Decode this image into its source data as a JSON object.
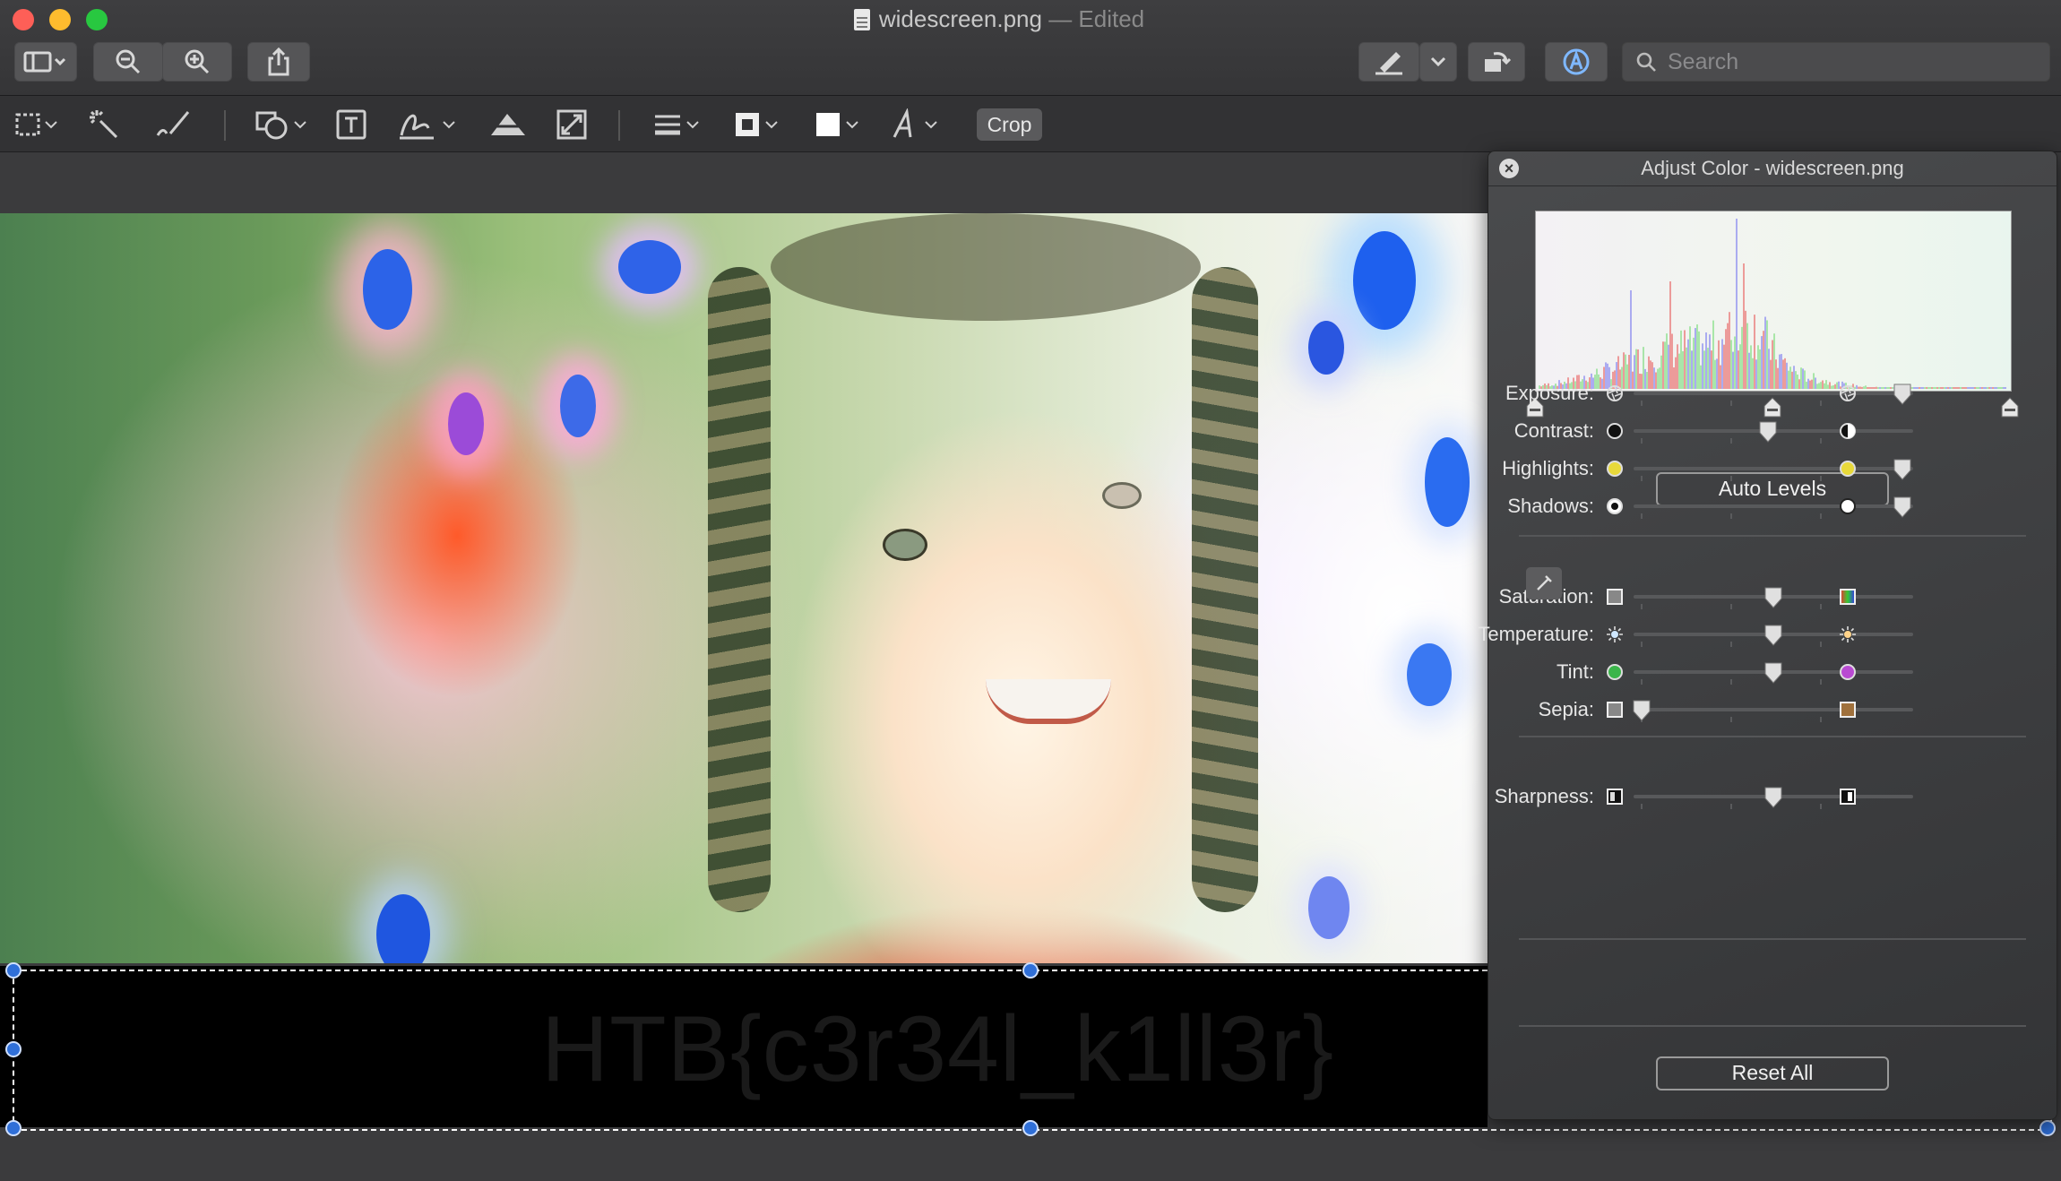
{
  "window": {
    "filename": "widescreen.png",
    "status": " — Edited"
  },
  "search": {
    "placeholder": "Search"
  },
  "markup_toolbar": {
    "crop_label": "Crop"
  },
  "image": {
    "caption_text": "HTB{c3r34l_k1ll3r}"
  },
  "adjust_panel": {
    "title": "Adjust Color - widescreen.png",
    "auto_levels_label": "Auto Levels",
    "reset_label": "Reset All",
    "sliders": [
      {
        "label": "Exposure:",
        "value": 0.96,
        "left_icon": "aperture-icon",
        "right_icon": "aperture-icon"
      },
      {
        "label": "Contrast:",
        "value": 0.48,
        "left_icon": "circle-filled-icon",
        "right_icon": "half-circle-icon"
      },
      {
        "label": "Highlights:",
        "value": 0.96,
        "left_icon": "yellow-circle-icon",
        "right_icon": "yellow-circle-icon"
      },
      {
        "label": "Shadows:",
        "value": 0.96,
        "left_icon": "dot-circle-icon",
        "right_icon": "white-circle-icon"
      },
      {
        "label": "Saturation:",
        "value": 0.5,
        "left_icon": "grey-square-icon",
        "right_icon": "rainbow-square-icon"
      },
      {
        "label": "Temperature:",
        "value": 0.5,
        "left_icon": "cold-sun-icon",
        "right_icon": "warm-sun-icon"
      },
      {
        "label": "Tint:",
        "value": 0.5,
        "left_icon": "green-circle-icon",
        "right_icon": "magenta-circle-icon"
      },
      {
        "label": "Sepia:",
        "value": 0.03,
        "left_icon": "grey-square-icon",
        "right_icon": "sepia-square-icon"
      },
      {
        "label": "Sharpness:",
        "value": 0.5,
        "left_icon": "soft-square-icon",
        "right_icon": "sharp-square-icon"
      }
    ],
    "histogram_levels": [
      0.0,
      0.5,
      1.0
    ]
  },
  "colors": {
    "accent_handle": "#2f6fd8",
    "histogram_red": "#e84b4b",
    "histogram_green": "#68d868",
    "histogram_blue": "#6b6bf0"
  }
}
